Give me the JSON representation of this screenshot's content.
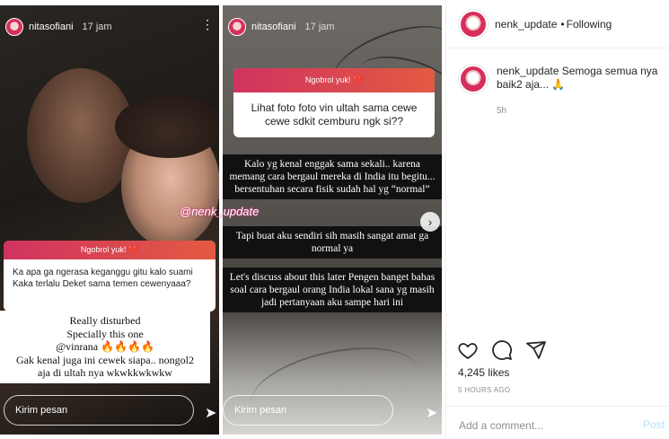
{
  "story1": {
    "username": "nitasofiani",
    "time": "17 jam",
    "question_header": "Ngobrol yuk! ❤️",
    "question_text": "Ka apa ga ngerasa keganggu gitu kalo suami Kaka terlalu Deket sama temen cewenyaaa?",
    "answer_lines": [
      "Really disturbed",
      "Specially this one",
      "@vinrana 🔥🔥🔥🔥",
      "Gak kenal juga ini cewek siapa.. nongol2",
      "aja di ultah nya wkwkkwkwkw"
    ],
    "reply_placeholder": "Kirim pesan"
  },
  "story2": {
    "username": "nitasofiani",
    "time": "17 jam",
    "question_header": "Ngobrol yuk! ❤️",
    "question_text": "Lihat foto foto vin ultah sama cewe cewe sdkit cemburu ngk si??",
    "answer_block_1": "Kalo yg kenal enggak sama sekali.. karena memang cara bergaul mereka di India itu begitu... bersentuhan secara fisik sudah hal yg “normal”",
    "answer_block_2": "Tapi buat aku sendiri sih masih sangat amat ga normal ya",
    "answer_block_3": "Let's discuss about this later Pengen banget bahas soal cara bergaul orang India lokal sana yg masih jadi pertanyaan aku sampe hari ini",
    "reply_placeholder": "Kirim pesan"
  },
  "watermark": "@nenk_update",
  "post": {
    "username": "nenk_update",
    "separator": "•",
    "follow_status": "Following",
    "caption_user": "nenk_update",
    "caption_text": "Semoga semua nya baik2 aja... 🙏",
    "caption_time": "5h",
    "likes": "4,245 likes",
    "posted_ago": "5 HOURS AGO",
    "comment_placeholder": "Add a comment...",
    "post_button": "Post"
  },
  "icons": {
    "like": "heart-icon",
    "comment": "comment-icon",
    "share": "share-icon",
    "send": "send-icon",
    "next": "chevron-right-icon",
    "more": "more-icon"
  },
  "colors": {
    "question_gradient_start": "#d0335f",
    "question_gradient_end": "#e35a42",
    "avatar_ring": "#d62f5c",
    "post_button": "#b2dffc"
  }
}
